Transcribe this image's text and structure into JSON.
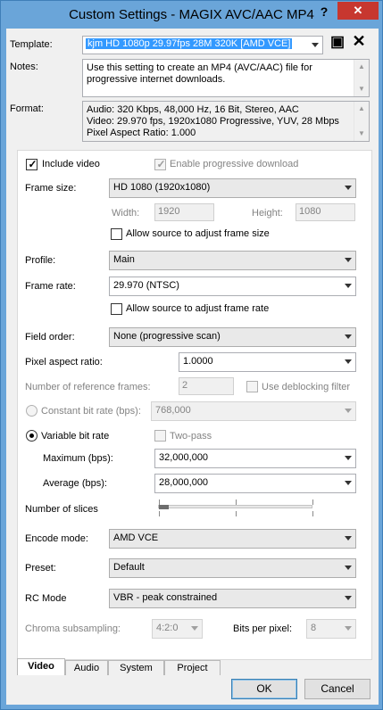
{
  "window": {
    "title": "Custom Settings - MAGIX AVC/AAC MP4",
    "help_glyph": "?",
    "close_glyph": "✕"
  },
  "header": {
    "template_label": "Template:",
    "template_value": "kjm HD 1080p 29.97fps 28M 320K [AMD VCE]",
    "save_glyph": "▣",
    "delete_glyph": "✕",
    "notes_label": "Notes:",
    "notes_line1": "Use this setting to create an MP4 (AVC/AAC) file for",
    "notes_line2": "progressive internet downloads.",
    "format_label": "Format:",
    "format_line1": "Audio: 320 Kbps, 48,000 Hz, 16 Bit, Stereo, AAC",
    "format_line2": "Video: 29.970 fps, 1920x1080 Progressive, YUV, 28 Mbps",
    "format_line3": "Pixel Aspect Ratio: 1.000"
  },
  "video": {
    "include_video_label": "Include video",
    "include_video_checked": true,
    "progressive_label": "Enable progressive download",
    "progressive_checked": true,
    "frame_size_label": "Frame size:",
    "frame_size_value": "HD 1080 (1920x1080)",
    "width_label": "Width:",
    "width_value": "1920",
    "height_label": "Height:",
    "height_value": "1080",
    "allow_frame_size_label": "Allow source to adjust frame size",
    "profile_label": "Profile:",
    "profile_value": "Main",
    "frame_rate_label": "Frame rate:",
    "frame_rate_value": "29.970 (NTSC)",
    "allow_frame_rate_label": "Allow source to adjust frame rate",
    "field_order_label": "Field order:",
    "field_order_value": "None (progressive scan)",
    "pixel_aspect_label": "Pixel aspect ratio:",
    "pixel_aspect_value": "1.0000",
    "ref_frames_label": "Number of reference frames:",
    "ref_frames_value": "2",
    "deblocking_label": "Use deblocking filter",
    "cbr_label": "Constant bit rate (bps):",
    "cbr_value": "768,000",
    "vbr_label": "Variable bit rate",
    "two_pass_label": "Two-pass",
    "maximum_label": "Maximum (bps):",
    "maximum_value": "32,000,000",
    "average_label": "Average (bps):",
    "average_value": "28,000,000",
    "slices_label": "Number of slices",
    "slices_level": 0.0,
    "encode_mode_label": "Encode mode:",
    "encode_mode_value": "AMD VCE",
    "preset_label": "Preset:",
    "preset_value": "Default",
    "rc_mode_label": "RC Mode",
    "rc_mode_value": "VBR - peak constrained",
    "chroma_label": "Chroma subsampling:",
    "chroma_value": "4:2:0",
    "bits_label": "Bits per pixel:",
    "bits_value": "8"
  },
  "tabs": [
    {
      "label": "Video"
    },
    {
      "label": "Audio"
    },
    {
      "label": "System"
    },
    {
      "label": "Project"
    }
  ],
  "footer": {
    "ok_label": "OK",
    "cancel_label": "Cancel"
  }
}
